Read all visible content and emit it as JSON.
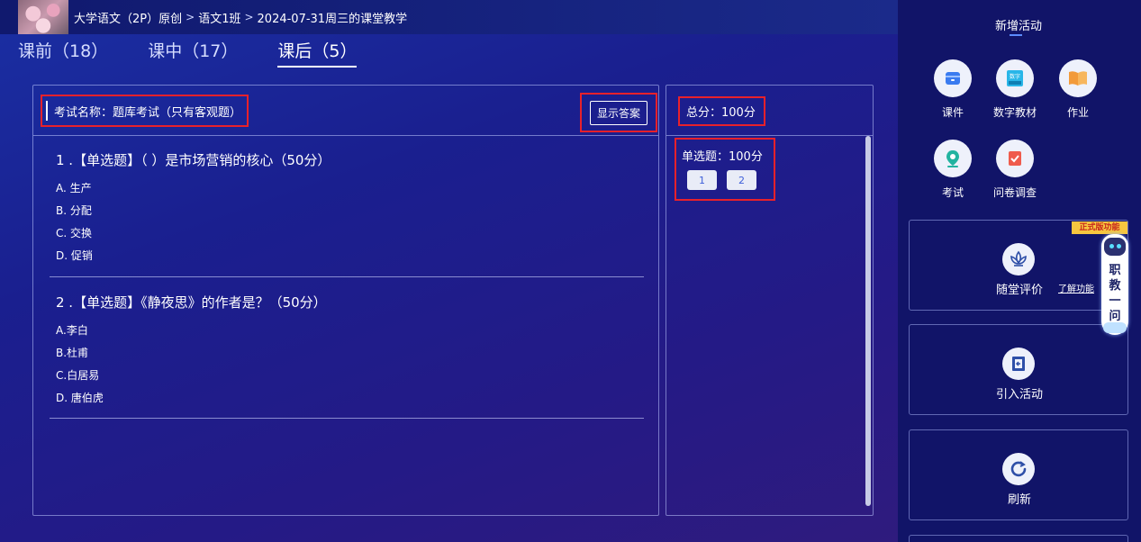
{
  "header": {
    "breadcrumb": [
      "大学语文（2P）原创",
      "语文1班",
      "2024-07-31周三的课堂教学"
    ],
    "separator": ">"
  },
  "tabs": [
    {
      "label": "课前（18）",
      "active": false
    },
    {
      "label": "课中（17）",
      "active": false
    },
    {
      "label": "课后（5）",
      "active": true
    }
  ],
  "exam": {
    "name_label": "考试名称：题库考试（只有客观题）",
    "show_answer_label": "显示答案"
  },
  "questions": [
    {
      "title": "1 .【单选题】（ ）是市场营销的核心（50分）",
      "options": [
        "A. 生产",
        "B. 分配",
        "C. 交换",
        "D. 促销"
      ]
    },
    {
      "title": "2 .【单选题】《静夜思》的作者是？（50分）",
      "options": [
        "A.李白",
        "B.杜甫",
        "C.白居易",
        "D. 唐伯虎"
      ]
    }
  ],
  "summary": {
    "total_label": "总分：100分",
    "single_choice_label": "单选题：100分",
    "question_numbers": [
      "1",
      "2"
    ]
  },
  "sidebar": {
    "title": "新增活动",
    "activities": [
      {
        "label": "课件",
        "icon": "courseware-icon"
      },
      {
        "label": "数字教材",
        "icon": "digital-textbook-icon",
        "icon_text": "数字"
      },
      {
        "label": "作业",
        "icon": "homework-book-icon"
      },
      {
        "label": "考试",
        "icon": "exam-pin-icon"
      },
      {
        "label": "问卷调查",
        "icon": "survey-icon"
      }
    ],
    "cards": [
      {
        "label": "随堂评价",
        "icon": "lotus-icon",
        "link": "了解功能"
      },
      {
        "label": "引入活动",
        "icon": "import-icon"
      },
      {
        "label": "刷新",
        "icon": "refresh-icon"
      }
    ],
    "assistant": {
      "tag": "正式版功能",
      "text": [
        "职",
        "教",
        "一",
        "问"
      ]
    }
  },
  "colors": {
    "highlight_border": "#e8212b",
    "background": "#1a1f8f",
    "sidebar": "#111468",
    "accent": "#5b8cff"
  }
}
